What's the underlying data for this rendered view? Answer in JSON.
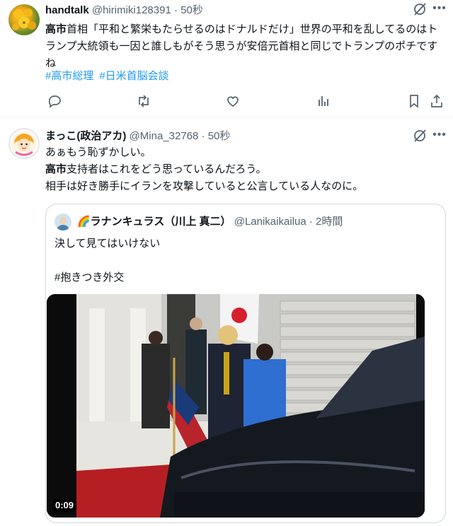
{
  "tweet1": {
    "author": "handtalk",
    "handle": "@hirimiki128391",
    "dot": "·",
    "time": "50秒",
    "text_bold": "高市",
    "text_rest": "首相「平和と繁栄もたらせるのはドナルドだけ」世界の平和を乱してるのはトランプ大統領も一因と誰しもがそう思うが安倍元首相と同じでトランプのポチですね",
    "hashtags": [
      "#高市総理",
      "#日米首脳会談"
    ]
  },
  "tweet2": {
    "author": "まっこ(政治アカ)",
    "handle": "@Mina_32768",
    "dot": "·",
    "time": "50秒",
    "line1": "あぁもう恥ずかしい。",
    "line2_bold": "高市",
    "line2_rest": "支持者はこれをどう思っているんだろう。",
    "line3": "相手は好き勝手にイランを攻撃していると公言している人なのに。",
    "quote": {
      "author": "🌈ラナンキュラス（川上 真二）",
      "handle": "@Lanikaikailua",
      "dot": "·",
      "time": "2時間",
      "text": "決して見てはいけない\n\n#抱きつき外交",
      "video_duration": "0:09"
    }
  },
  "colors": {
    "accent": "#1d9bf0",
    "muted": "#536471",
    "border": "#cfd9de"
  },
  "icons": [
    "grok-icon",
    "more-icon",
    "reply-icon",
    "retweet-icon",
    "like-icon",
    "views-icon",
    "bookmark-icon",
    "share-icon"
  ]
}
